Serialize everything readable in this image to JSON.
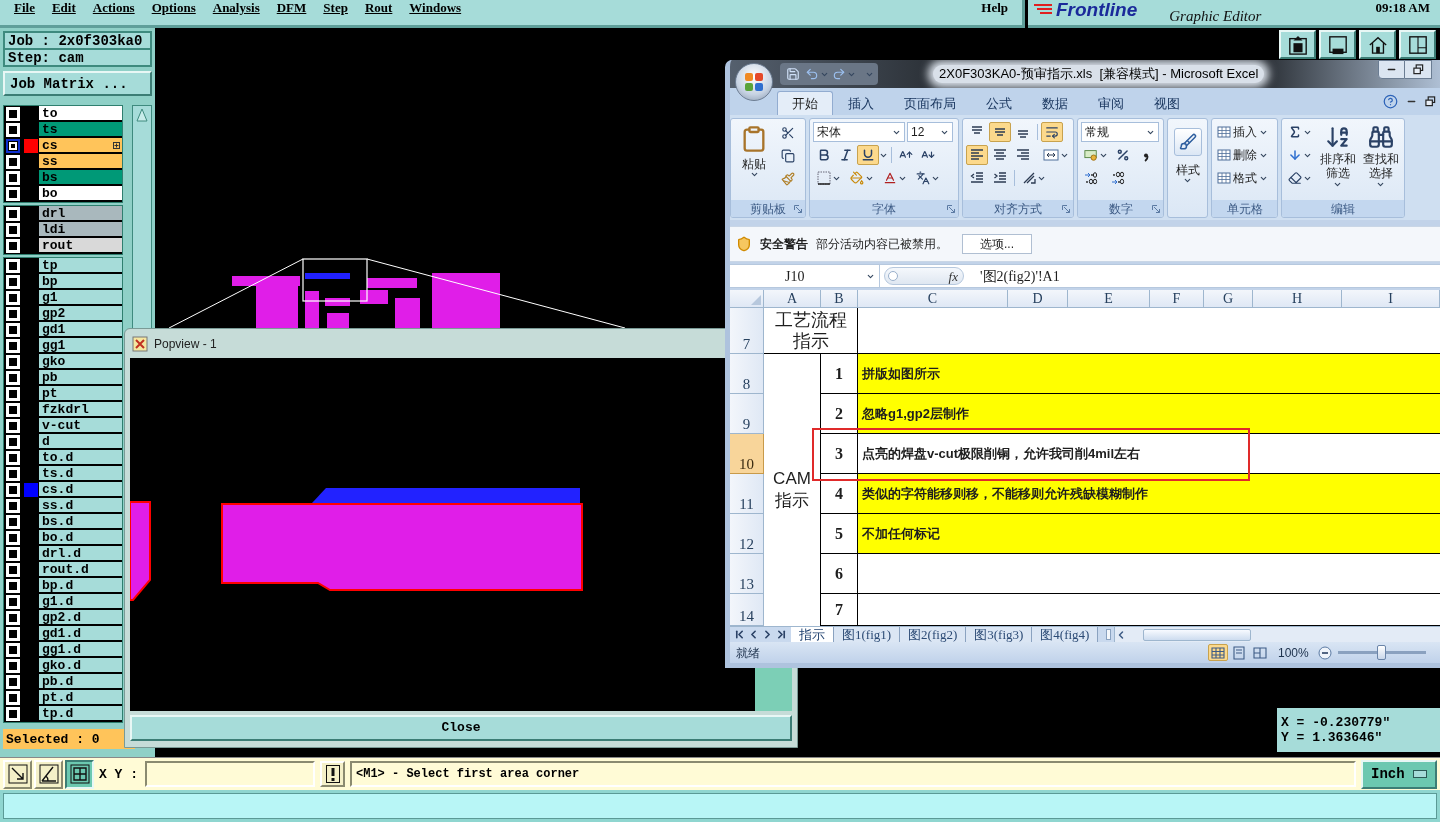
{
  "menu_bar": {
    "items": [
      "File",
      "Edit",
      "Actions",
      "Options",
      "Analysis",
      "DFM",
      "Step",
      "Rout",
      "Windows"
    ],
    "help": "Help"
  },
  "brand": {
    "logo": "Frontline",
    "subtitle": "Graphic Editor",
    "clock": "09:18 AM"
  },
  "job_panel": {
    "job": "Job : 2x0f303ka0",
    "step": "Step: cam",
    "matrix_button": "Job Matrix ...",
    "layer_groups": [
      {
        "layers": [
          {
            "name": "to",
            "color": "#ffffff",
            "checked": false,
            "focused": false
          },
          {
            "name": "ts",
            "color": "#009977",
            "checked": false,
            "focused": false
          },
          {
            "name": "cs",
            "color": "#ffc45a",
            "checked": false,
            "focused": true,
            "marker": {
              "color": "#ff0000"
            },
            "menu_mark": true
          },
          {
            "name": "ss",
            "color": "#ffc45a",
            "checked": false,
            "focused": false
          },
          {
            "name": "bs",
            "color": "#009977",
            "checked": false,
            "focused": false
          },
          {
            "name": "bo",
            "color": "#ffffff",
            "checked": false,
            "focused": false
          }
        ]
      },
      {
        "layers": [
          {
            "name": "drl",
            "color": "#a9b8bd",
            "checked": false,
            "focused": false
          },
          {
            "name": "ldi",
            "color": "#a9b8bd",
            "checked": false,
            "focused": false
          },
          {
            "name": "rout",
            "color": "#d9d9d9",
            "checked": false,
            "focused": false
          }
        ]
      },
      {
        "layers": [
          {
            "name": "tp",
            "color": "#a6dcd9",
            "checked": false,
            "focused": false
          },
          {
            "name": "bp",
            "color": "#a6dcd9",
            "checked": false,
            "focused": false
          },
          {
            "name": "g1",
            "color": "#a6dcd9",
            "checked": false,
            "focused": false
          },
          {
            "name": "gp2",
            "color": "#a6dcd9",
            "checked": false,
            "focused": false
          },
          {
            "name": "gd1",
            "color": "#a6dcd9",
            "checked": false,
            "focused": false
          },
          {
            "name": "gg1",
            "color": "#a6dcd9",
            "checked": false,
            "focused": false
          },
          {
            "name": "gko",
            "color": "#a6dcd9",
            "checked": false,
            "focused": false
          },
          {
            "name": "pb",
            "color": "#a6dcd9",
            "checked": false,
            "focused": false
          },
          {
            "name": "pt",
            "color": "#a6dcd9",
            "checked": false,
            "focused": false
          },
          {
            "name": "fzkdrl",
            "color": "#a6dcd9",
            "checked": false,
            "focused": false
          },
          {
            "name": "v-cut",
            "color": "#a6dcd9",
            "checked": false,
            "focused": false
          },
          {
            "name": "d",
            "color": "#a6dcd9",
            "checked": false,
            "focused": false
          },
          {
            "name": "to.d",
            "color": "#a6dcd9",
            "checked": false,
            "focused": false
          },
          {
            "name": "ts.d",
            "color": "#a6dcd9",
            "checked": false,
            "focused": false
          },
          {
            "name": "cs.d",
            "color": "#a6dcd9",
            "checked": false,
            "focused": false,
            "marker": {
              "color": "#0000ff"
            }
          },
          {
            "name": "ss.d",
            "color": "#a6dcd9",
            "checked": false,
            "focused": false
          },
          {
            "name": "bs.d",
            "color": "#a6dcd9",
            "checked": false,
            "focused": false
          },
          {
            "name": "bo.d",
            "color": "#a6dcd9",
            "checked": false,
            "focused": false
          },
          {
            "name": "drl.d",
            "color": "#a6dcd9",
            "checked": false,
            "focused": false
          },
          {
            "name": "rout.d",
            "color": "#a6dcd9",
            "checked": false,
            "focused": false
          },
          {
            "name": "bp.d",
            "color": "#a6dcd9",
            "checked": false,
            "focused": false
          },
          {
            "name": "g1.d",
            "color": "#a6dcd9",
            "checked": false,
            "focused": false
          },
          {
            "name": "gp2.d",
            "color": "#a6dcd9",
            "checked": false,
            "focused": false
          },
          {
            "name": "gd1.d",
            "color": "#a6dcd9",
            "checked": false,
            "focused": false
          },
          {
            "name": "gg1.d",
            "color": "#a6dcd9",
            "checked": false,
            "focused": false
          },
          {
            "name": "gko.d",
            "color": "#a6dcd9",
            "checked": false,
            "focused": false
          },
          {
            "name": "pb.d",
            "color": "#a6dcd9",
            "checked": false,
            "focused": false
          },
          {
            "name": "pt.d",
            "color": "#a6dcd9",
            "checked": false,
            "focused": false
          },
          {
            "name": "tp.d",
            "color": "#a6dcd9",
            "checked": false,
            "focused": false
          }
        ]
      }
    ],
    "selected_count": "Selected : 0"
  },
  "popview": {
    "title": "Popview - 1",
    "close_button": "Close"
  },
  "excel": {
    "title": "2X0F303KA0-预审指示.xls  [兼容模式] - Microsoft Excel",
    "tabs": [
      {
        "label": "开始",
        "selected": true
      },
      {
        "label": "插入",
        "selected": false
      },
      {
        "label": "页面布局",
        "selected": false
      },
      {
        "label": "公式",
        "selected": false
      },
      {
        "label": "数据",
        "selected": false
      },
      {
        "label": "审阅",
        "selected": false
      },
      {
        "label": "视图",
        "selected": false
      }
    ],
    "ribbon": {
      "clipboard": {
        "paste": "粘贴",
        "label": "剪贴板"
      },
      "font": {
        "family": "宋体",
        "size": "12",
        "toggles": [
          {
            "kind": "bold",
            "selected": false
          },
          {
            "kind": "italic",
            "selected": false
          },
          {
            "kind": "underline",
            "selected": true
          }
        ],
        "label": "字体"
      },
      "alignment": {
        "vertical": [
          {
            "kind": "top",
            "selected": false
          },
          {
            "kind": "middle",
            "selected": true
          },
          {
            "kind": "bottom",
            "selected": false
          }
        ],
        "wrap_text": {
          "selected": true
        },
        "horizontal": [
          {
            "kind": "left",
            "selected": true
          },
          {
            "kind": "center",
            "selected": false
          },
          {
            "kind": "right",
            "selected": false
          }
        ],
        "label": "对齐方式"
      },
      "number": {
        "format": "常规",
        "label": "数字"
      },
      "styles": {
        "button": "样式"
      },
      "cells": {
        "buttons": [
          "插入",
          "删除",
          "格式"
        ],
        "label": "单元格"
      },
      "editing": {
        "sort_filter": [
          "排序和",
          "筛选"
        ],
        "find_select": [
          "查找和",
          "选择"
        ],
        "label": "编辑"
      }
    },
    "security_bar": {
      "title": "安全警告",
      "message": "部分活动内容已被禁用。",
      "button": "选项..."
    },
    "formula_bar": {
      "name_box": "J10",
      "function_button": "fx",
      "formula": "'图2(fig2)'!A1"
    },
    "sheet": {
      "columns": [
        "A",
        "B",
        "C",
        "D",
        "E",
        "F",
        "G",
        "H",
        "I"
      ],
      "title_row": {
        "row": "7",
        "lines": [
          "工艺流程",
          "指示"
        ],
        "selected": false
      },
      "section": {
        "lines": [
          "CAM",
          "指示"
        ]
      },
      "items": [
        {
          "row": "8",
          "number": "1",
          "text": "拼版如图所示",
          "color": "#ffff00",
          "selected": false,
          "marked": false
        },
        {
          "row": "9",
          "number": "2",
          "text": "忽略g1,gp2层制作",
          "color": "#ffff00",
          "selected": false,
          "marked": false
        },
        {
          "row": "10",
          "number": "3",
          "text": "点亮的焊盘v-cut极限削铜，允许我司削4mil左右",
          "color": "#ffffff",
          "selected": true,
          "marked": true
        },
        {
          "row": "11",
          "number": "4",
          "text": "类似的字符能移则移，不能移则允许残缺模糊制作",
          "color": "#ffff00",
          "selected": false,
          "marked": false
        },
        {
          "row": "12",
          "number": "5",
          "text": "不加任何标记",
          "color": "#ffff00",
          "selected": false,
          "marked": false
        },
        {
          "row": "13",
          "number": "6",
          "color": "#ffffff",
          "selected": false,
          "marked": false
        },
        {
          "row": "14",
          "number": "7",
          "color": "#ffffff",
          "selected": false,
          "marked": false
        }
      ]
    },
    "sheet_tabs": [
      {
        "label": "指示",
        "selected": true
      },
      {
        "label": "图1(fig1)",
        "selected": false
      },
      {
        "label": "图2(fig2)",
        "selected": false
      },
      {
        "label": "图3(fig3)",
        "selected": false
      },
      {
        "label": "图4(fig4)",
        "selected": false
      }
    ],
    "status_bar": {
      "status": "就绪",
      "views": [
        {
          "kind": "normal",
          "selected": true
        },
        {
          "kind": "page_layout",
          "selected": false
        },
        {
          "kind": "page_break",
          "selected": false
        }
      ],
      "zoom": {
        "label": "100%",
        "level": 0.5
      }
    }
  },
  "coordinates": {
    "x": "X = -0.230779\"",
    "y": "Y = 1.363646\""
  },
  "status_bar": {
    "tools": [
      {
        "kind": "zoom_box",
        "selected": false
      },
      {
        "kind": "measure",
        "selected": false
      },
      {
        "kind": "snap_grid",
        "selected": true
      }
    ],
    "xy_label": "X Y :",
    "prompt": "<M1> - Select first area corner",
    "units": "Inch"
  }
}
